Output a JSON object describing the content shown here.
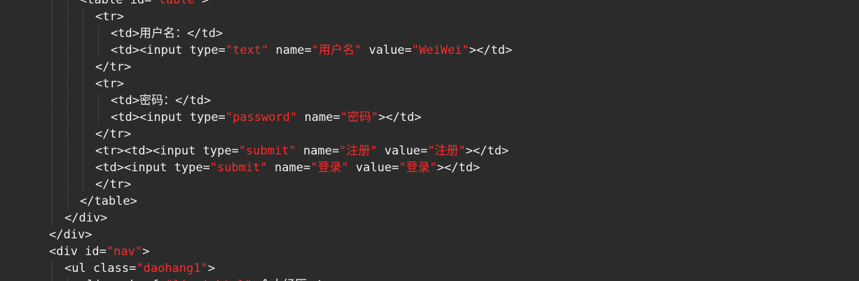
{
  "editor": {
    "background": "#2b2b2b",
    "text_color": "#f2f2f2",
    "string_color": "#ff2b2b",
    "lines": [
      {
        "indent": 3,
        "segments": [
          {
            "text": "<table id=",
            "kind": "t"
          },
          {
            "text": "\"table\"",
            "kind": "s"
          },
          {
            "text": ">",
            "kind": "t"
          }
        ]
      },
      {
        "indent": 4,
        "segments": [
          {
            "text": "<tr>",
            "kind": "t"
          }
        ]
      },
      {
        "indent": 5,
        "segments": [
          {
            "text": "<td>用户名：</td>",
            "kind": "t"
          }
        ]
      },
      {
        "indent": 5,
        "segments": [
          {
            "text": "<td><input type=",
            "kind": "t"
          },
          {
            "text": "\"text\"",
            "kind": "s"
          },
          {
            "text": " name=",
            "kind": "t"
          },
          {
            "text": "\"用户名\"",
            "kind": "s"
          },
          {
            "text": " value=",
            "kind": "t"
          },
          {
            "text": "\"WeiWei\"",
            "kind": "s"
          },
          {
            "text": "></td>",
            "kind": "t"
          }
        ]
      },
      {
        "indent": 4,
        "segments": [
          {
            "text": "</tr>",
            "kind": "t"
          }
        ]
      },
      {
        "indent": 4,
        "segments": [
          {
            "text": "<tr>",
            "kind": "t"
          }
        ]
      },
      {
        "indent": 5,
        "segments": [
          {
            "text": "<td>密码：</td>",
            "kind": "t"
          }
        ]
      },
      {
        "indent": 5,
        "segments": [
          {
            "text": "<td><input type=",
            "kind": "t"
          },
          {
            "text": "\"password\"",
            "kind": "s"
          },
          {
            "text": " name=",
            "kind": "t"
          },
          {
            "text": "\"密码\"",
            "kind": "s"
          },
          {
            "text": "></td>",
            "kind": "t"
          }
        ]
      },
      {
        "indent": 4,
        "segments": [
          {
            "text": "</tr>",
            "kind": "t"
          }
        ]
      },
      {
        "indent": 4,
        "segments": [
          {
            "text": "<tr><td><input type=",
            "kind": "t"
          },
          {
            "text": "\"submit\"",
            "kind": "s"
          },
          {
            "text": " name=",
            "kind": "t"
          },
          {
            "text": "\"注册\"",
            "kind": "s"
          },
          {
            "text": " value=",
            "kind": "t"
          },
          {
            "text": "\"注册\"",
            "kind": "s"
          },
          {
            "text": "></td>",
            "kind": "t"
          }
        ]
      },
      {
        "indent": 4,
        "segments": [
          {
            "text": "<td><input type=",
            "kind": "t"
          },
          {
            "text": "\"submit\"",
            "kind": "s"
          },
          {
            "text": " name=",
            "kind": "t"
          },
          {
            "text": "\"登录\"",
            "kind": "s"
          },
          {
            "text": " value=",
            "kind": "t"
          },
          {
            "text": "\"登录\"",
            "kind": "s"
          },
          {
            "text": "></td>",
            "kind": "t"
          }
        ]
      },
      {
        "indent": 4,
        "segments": [
          {
            "text": "</tr>",
            "kind": "t"
          }
        ]
      },
      {
        "indent": 3,
        "segments": [
          {
            "text": "</table>",
            "kind": "t"
          }
        ]
      },
      {
        "indent": 2,
        "segments": [
          {
            "text": "</div>",
            "kind": "t"
          }
        ]
      },
      {
        "indent": 1,
        "segments": [
          {
            "text": "</div>",
            "kind": "t"
          }
        ]
      },
      {
        "indent": 1,
        "segments": [
          {
            "text": "<div id=",
            "kind": "t"
          },
          {
            "text": "\"nav\"",
            "kind": "s"
          },
          {
            "text": ">",
            "kind": "t"
          }
        ]
      },
      {
        "indent": 2,
        "segments": [
          {
            "text": "<ul class=",
            "kind": "t"
          },
          {
            "text": "\"daohang1\"",
            "kind": "s"
          },
          {
            "text": ">",
            "kind": "t"
          }
        ]
      },
      {
        "indent": 3,
        "segments": [
          {
            "text": "<li><a href=",
            "kind": "t"
          },
          {
            "text": "\"liuyi.html\"",
            "kind": "s"
          },
          {
            "text": ">个人经历</a>",
            "kind": "t"
          }
        ]
      }
    ]
  }
}
